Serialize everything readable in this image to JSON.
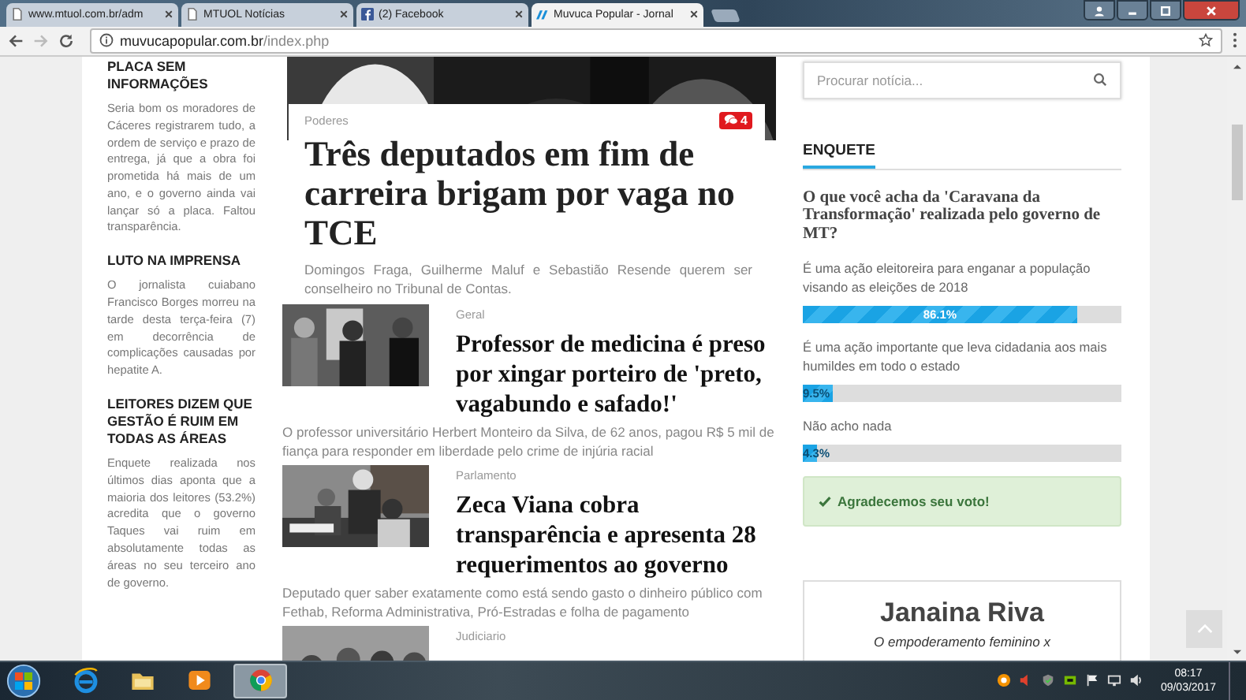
{
  "browser": {
    "tabs": [
      {
        "title": "www.mtuol.com.br/adm",
        "kind": "page",
        "selected": false
      },
      {
        "title": "MTUOL Notícias",
        "kind": "page",
        "selected": false
      },
      {
        "title": "(2) Facebook",
        "kind": "facebook",
        "selected": false
      },
      {
        "title": "Muvuca Popular - Jornal",
        "kind": "site",
        "selected": true
      }
    ],
    "address": {
      "domain": "muvucapopular.com.br",
      "path": "/index.php"
    }
  },
  "left_column": {
    "items": [
      {
        "title": "PLACA SEM INFORMAÇÕES",
        "text": "Seria bom os moradores de Cáceres registrarem tudo, a ordem de serviço e prazo de entrega, já que a obra foi prometida há mais de um ano, e o governo ainda vai lançar só a placa. Faltou transparência."
      },
      {
        "title": "LUTO NA IMPRENSA",
        "text": "O jornalista cuiabano Francisco Borges morreu na tarde desta terça-feira (7) em decorrência de complicações causadas por hepatite A."
      },
      {
        "title": "LEITORES DIZEM QUE GESTÃO É RUIM EM TODAS AS ÁREAS",
        "text": "Enquete realizada nos últimos dias aponta que a maioria dos leitores (53.2%) acredita que o governo Taques vai ruim em absolutamente todas as áreas no seu terceiro ano de governo."
      }
    ]
  },
  "main": {
    "lead": {
      "category": "Poderes",
      "comments": "4",
      "title": "Três deputados em fim de carreira brigam por vaga no TCE",
      "summary": "Domingos Fraga, Guilherme Maluf e Sebastião Resende querem ser conselheiro no Tribunal de Contas."
    },
    "articles": [
      {
        "category": "Geral",
        "title": "Professor de medicina é preso por xingar porteiro de 'preto, vagabundo e safado!'",
        "summary": "O professor universitário Herbert Monteiro da Silva, de 62 anos, pagou R$ 5 mil de fiança para responder em liberdade pelo crime de injúria racial"
      },
      {
        "category": "Parlamento",
        "title": "Zeca Viana cobra transparência e apresenta 28 requerimentos ao governo",
        "summary": "Deputado quer saber exatamente como está sendo gasto o dinheiro público com Fethab, Reforma Administrativa, Pró-Estradas e folha de pagamento"
      },
      {
        "category": "Judiciario"
      }
    ]
  },
  "sidebar": {
    "search": {
      "placeholder": "Procurar notícia..."
    },
    "poll": {
      "heading": "ENQUETE",
      "question": "O que você acha da 'Caravana da Transformação' realizada pelo governo de MT?",
      "options": [
        {
          "label": "É uma ação eleitoreira para enganar a população visando as eleições de 2018",
          "level": 0.861,
          "reading": "86.1%"
        },
        {
          "label": "É uma ação importante que leva cidadania aos mais humildes em todo o estado",
          "level": 0.095,
          "reading": "9.5%"
        },
        {
          "label": "Não acho nada",
          "level": 0.043,
          "reading": "4.3%"
        }
      ],
      "message": "Agradecemos seu voto!"
    },
    "columnist": {
      "name": "Janaina Riva",
      "subtitle": "O empoderamento feminino x"
    }
  },
  "taskbar": {
    "apps": [
      {
        "kind": "ie",
        "selected": false
      },
      {
        "kind": "explorer",
        "selected": false
      },
      {
        "kind": "media",
        "selected": false
      },
      {
        "kind": "chrome",
        "selected": true
      }
    ],
    "time": "08:17",
    "date": "09/03/2017"
  }
}
